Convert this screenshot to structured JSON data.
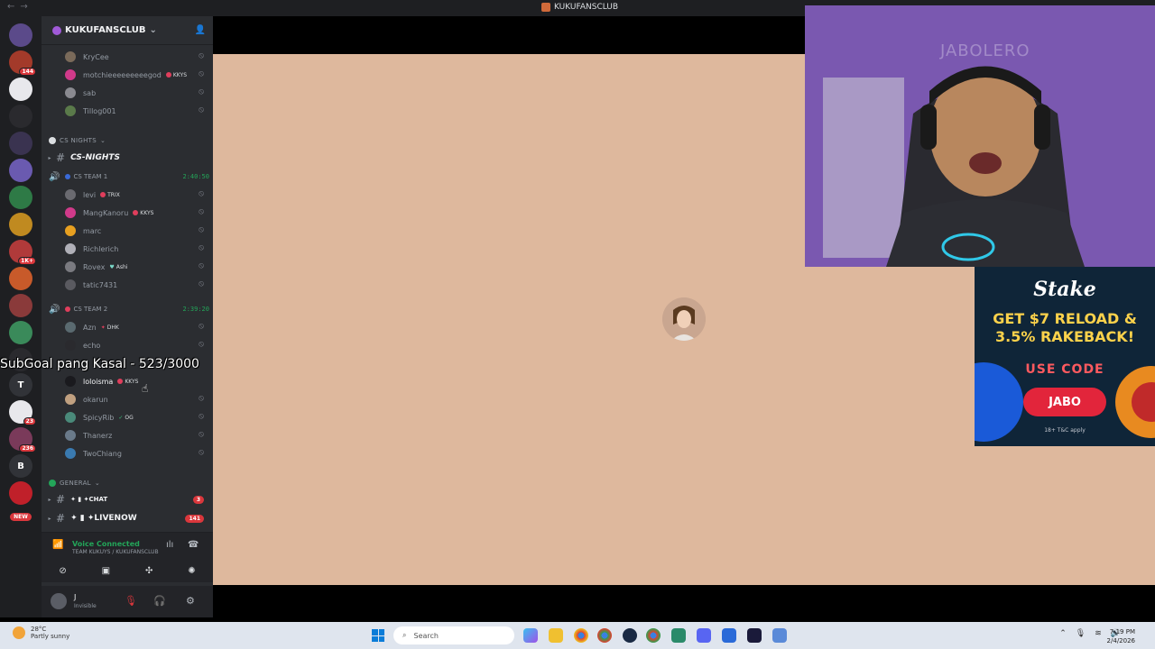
{
  "window": {
    "title": "KUKUFANSCLUB"
  },
  "server": {
    "name": "KUKUFANSCLUB"
  },
  "rail": {
    "badges": [
      "144",
      "1K+",
      "23",
      "236"
    ],
    "letters": [
      "T",
      "B"
    ],
    "new_label": "NEW"
  },
  "top_users": [
    {
      "name": "KryCee"
    },
    {
      "name": "motchieeeeeeeeegod",
      "tag": "KKYS"
    },
    {
      "name": "sab"
    },
    {
      "name": "Tillog001"
    }
  ],
  "categories": {
    "cs_nights": "CS NIGHTS",
    "general": "GENERAL"
  },
  "channels": {
    "cs_nights": "CS-NIGHTS",
    "chat": "✦ ▮ ✦CHAT",
    "chat_count": "3",
    "livenow": "✦ ▮ ✦LIVENOW",
    "livenow_count": "141"
  },
  "team1": {
    "name": "CS TEAM 1",
    "timer": "2:40:50",
    "members": [
      {
        "name": "levi",
        "tag": "TRIX"
      },
      {
        "name": "MangKanoru",
        "tag": "KKYS"
      },
      {
        "name": "marc"
      },
      {
        "name": "Richlerich"
      },
      {
        "name": "Rovex",
        "tag": "Ashi"
      },
      {
        "name": "tatic7431"
      }
    ]
  },
  "team2": {
    "name": "CS TEAM 2",
    "timer": "2:39:20",
    "members": [
      {
        "name": "Azn",
        "tag": "DHK"
      },
      {
        "name": "echo"
      },
      {
        "name": "loloisma",
        "tag": "KKYS"
      },
      {
        "name": "okarun"
      },
      {
        "name": "SpicyRib",
        "tag": "OG"
      },
      {
        "name": "Thanerz"
      },
      {
        "name": "TwoChiang"
      }
    ]
  },
  "voice": {
    "status": "Voice Connected",
    "location": "TEAM KUKUYS / KUKUFANSCLUB"
  },
  "user": {
    "name": "J",
    "status": "Invisible"
  },
  "overlay": {
    "subgoal": "SubGoal pang Kasal - 523/3000"
  },
  "webcam": {
    "watermark": "JABOLERO"
  },
  "ad": {
    "brand": "Stake",
    "headline_1": "GET $7 RELOAD &",
    "headline_2": "3.5% RAKEBACK!",
    "use_code": "USE CODE",
    "code": "JABO",
    "terms": "18+ T&C apply"
  },
  "taskbar": {
    "weather_temp": "28°C",
    "weather_desc": "Partly sunny",
    "search_placeholder": "Search",
    "time": "7:19 PM",
    "date": "2/4/2026"
  },
  "colors": {
    "accent_green": "#23a559",
    "badge_red": "#da373c",
    "canvas": "#deb89d"
  }
}
